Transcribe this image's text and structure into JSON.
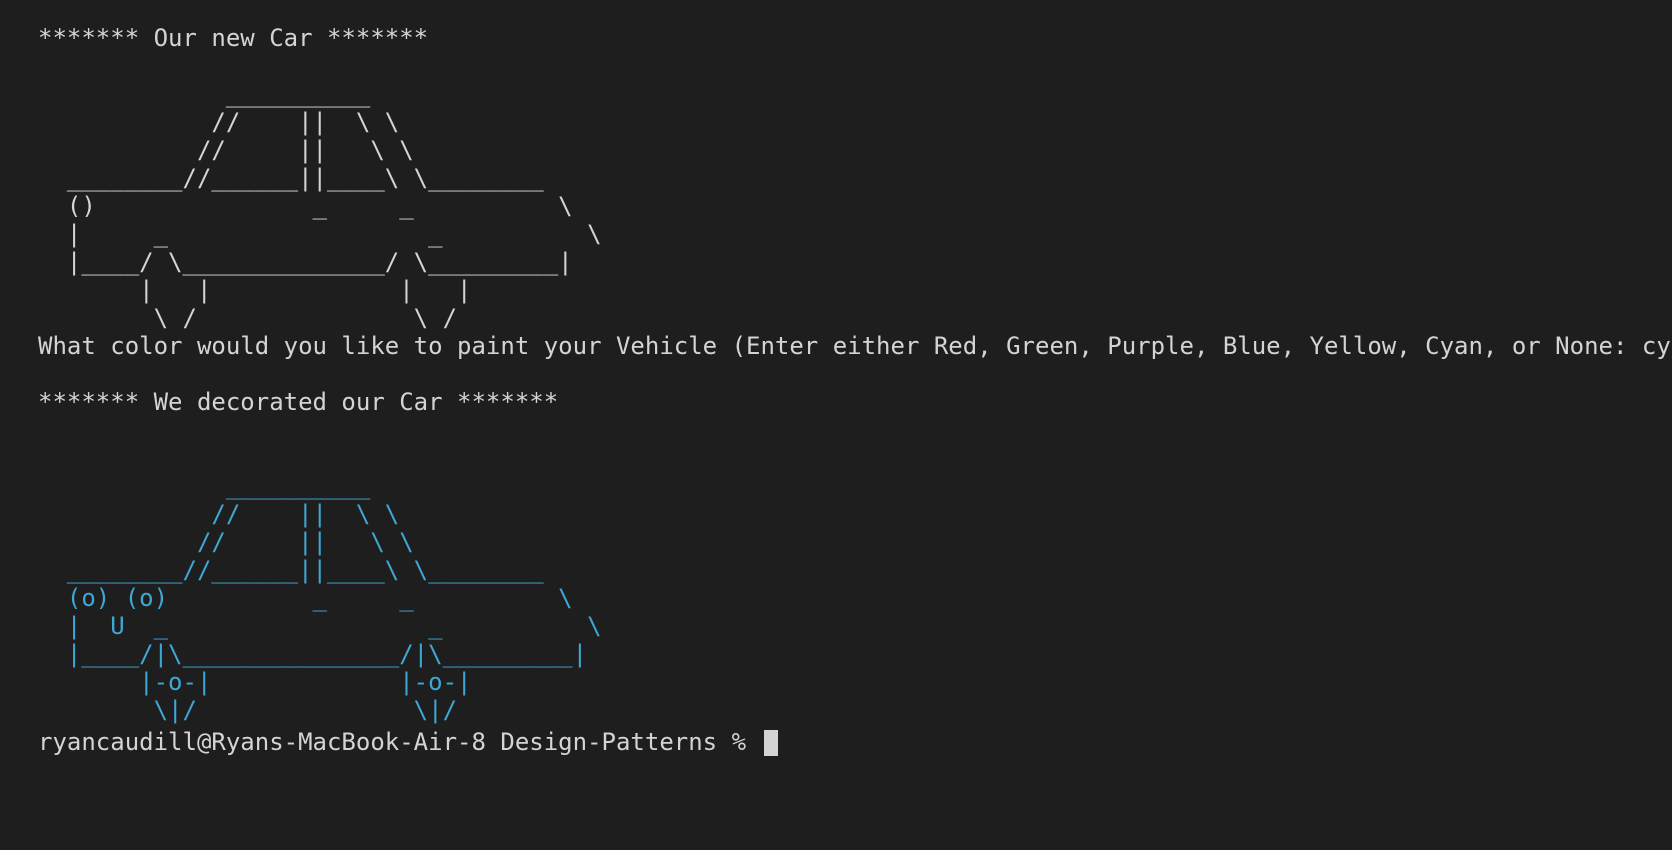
{
  "terminal": {
    "header_new": "******* Our new Car *******",
    "car_plain_ascii": "             __________\n            //    ||  \\ \\\n           //     ||   \\ \\\n  ________//______||____\\ \\________\n  ()               _     _          \\\n  |     _                  _          \\\n  |____/ \\______________/ \\_________|\n       |   |             |   |\n        \\ /               \\ /",
    "question": "What color would you like to paint your Vehicle (Enter either Red, Green, Purple, Blue, Yellow, Cyan, or None: cyan",
    "header_decorated": "******* We decorated our Car *******",
    "car_decorated_ascii": "             __________\n            //    ||  \\ \\\n           //     ||   \\ \\\n  ________//______||____\\ \\________\n  (o) (o)          _     _          \\\n  |  U  _                  _          \\\n  |____/|\\_______________/|\\_________|\n       |-o-|             |-o-|\n        \\|/               \\|/",
    "prompt": "ryancaudill@Ryans-MacBook-Air-8 Design-Patterns %",
    "colors": {
      "background": "#1e1e1e",
      "text": "#d4d4d4",
      "decorated_car": "#3fa7d6"
    }
  }
}
